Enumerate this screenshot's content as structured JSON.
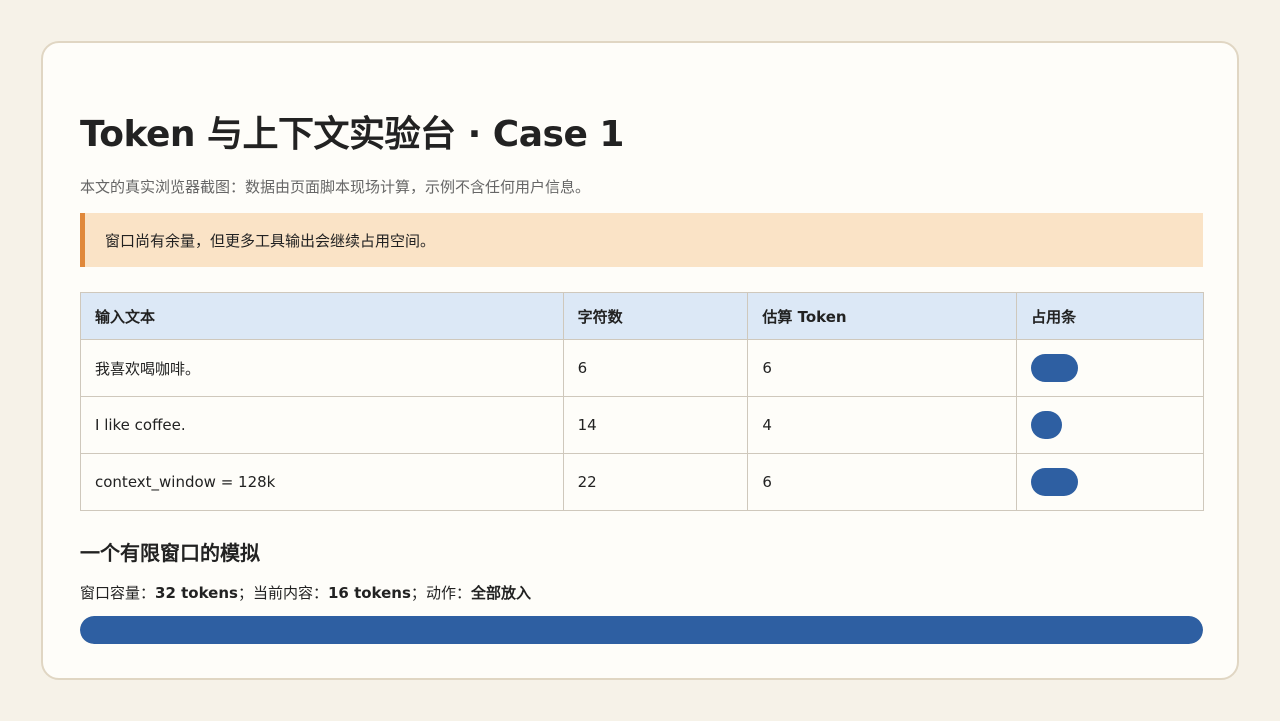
{
  "page": {
    "title": "Token 与上下文实验台 · Case 1",
    "subtitle": "本文的真实浏览器截图：数据由页面脚本现场计算，示例不含任何用户信息。",
    "notice": "窗口尚有余量，但更多工具输出会继续占用空间。"
  },
  "table": {
    "headers": [
      "输入文本",
      "字符数",
      "估算 Token",
      "占用条"
    ],
    "rows": [
      {
        "text": "我喜欢喝咖啡。",
        "chars": "6",
        "tokens": "6",
        "bar_fraction": 0.1875
      },
      {
        "text": "I like coffee.",
        "chars": "14",
        "tokens": "4",
        "bar_fraction": 0.125
      },
      {
        "text": "context_window = 128k",
        "chars": "22",
        "tokens": "6",
        "bar_fraction": 0.1875
      }
    ]
  },
  "simulation": {
    "title": "一个有限窗口的模拟",
    "capacity_label": "窗口容量：",
    "capacity_value": "32 tokens",
    "sep1": "；",
    "current_label": "当前内容：",
    "current_value": "16 tokens",
    "sep2": "；",
    "action_label": "动作：",
    "action_value": "全部放入",
    "fill_fraction": 1.0
  },
  "colors": {
    "accent": "#2e5fa2",
    "notice_bg": "#fae3c6",
    "notice_border": "#e0883a",
    "table_header_bg": "#dce8f6"
  }
}
